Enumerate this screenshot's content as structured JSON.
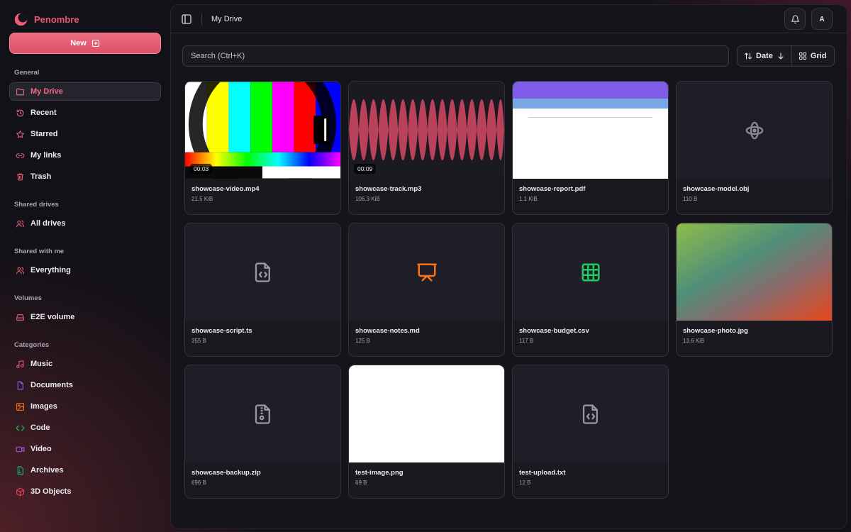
{
  "app": {
    "name": "Penombre",
    "brand_color": "#ea5d74"
  },
  "sidebar": {
    "new_label": "New",
    "sections": [
      {
        "label": "General",
        "items": [
          {
            "label": "My Drive",
            "icon": "folder-icon",
            "active": true
          },
          {
            "label": "Recent",
            "icon": "clock-icon"
          },
          {
            "label": "Starred",
            "icon": "star-icon"
          },
          {
            "label": "My links",
            "icon": "link-icon"
          },
          {
            "label": "Trash",
            "icon": "trash-icon"
          }
        ]
      },
      {
        "label": "Shared drives",
        "items": [
          {
            "label": "All drives",
            "icon": "users-icon"
          }
        ]
      },
      {
        "label": "Shared with me",
        "items": [
          {
            "label": "Everything",
            "icon": "users-icon"
          }
        ]
      },
      {
        "label": "Volumes",
        "items": [
          {
            "label": "E2E volume",
            "icon": "hard-drive-icon"
          }
        ]
      },
      {
        "label": "Categories",
        "items": [
          {
            "label": "Music",
            "icon": "music-icon",
            "color": "#ec4899"
          },
          {
            "label": "Documents",
            "icon": "document-icon",
            "color": "#8b5cf6"
          },
          {
            "label": "Images",
            "icon": "image-icon",
            "color": "#f97316"
          },
          {
            "label": "Code",
            "icon": "code-icon",
            "color": "#22c55e"
          },
          {
            "label": "Video",
            "icon": "video-icon",
            "color": "#a855f7"
          },
          {
            "label": "Archives",
            "icon": "archive-icon",
            "color": "#10b981"
          },
          {
            "label": "3D Objects",
            "icon": "cube-icon",
            "color": "#f43f5e"
          }
        ]
      }
    ]
  },
  "header": {
    "title": "My Drive",
    "avatar_initial": "A"
  },
  "toolbar": {
    "search_placeholder": "Search (Ctrl+K)",
    "sort_label": "Date",
    "view_label": "Grid"
  },
  "files": [
    {
      "name": "showcase-video.mp4",
      "size": "21.5 KiB",
      "duration": "00:03",
      "thumb": "video"
    },
    {
      "name": "showcase-track.mp3",
      "size": "106.3 KiB",
      "duration": "00:09",
      "thumb": "audio"
    },
    {
      "name": "showcase-report.pdf",
      "size": "1.1 KiB",
      "thumb": "pdf"
    },
    {
      "name": "showcase-model.obj",
      "size": "110 B",
      "thumb": "model-icon"
    },
    {
      "name": "showcase-script.ts",
      "size": "355 B",
      "thumb": "code-file-icon"
    },
    {
      "name": "showcase-notes.md",
      "size": "125 B",
      "thumb": "presentation-icon"
    },
    {
      "name": "showcase-budget.csv",
      "size": "117 B",
      "thumb": "table-icon"
    },
    {
      "name": "showcase-photo.jpg",
      "size": "13.6 KiB",
      "thumb": "photo"
    },
    {
      "name": "showcase-backup.zip",
      "size": "696 B",
      "thumb": "zip-file-icon"
    },
    {
      "name": "test-image.png",
      "size": "69 B",
      "thumb": "white"
    },
    {
      "name": "test-upload.txt",
      "size": "12 B",
      "thumb": "code-file-icon"
    }
  ]
}
